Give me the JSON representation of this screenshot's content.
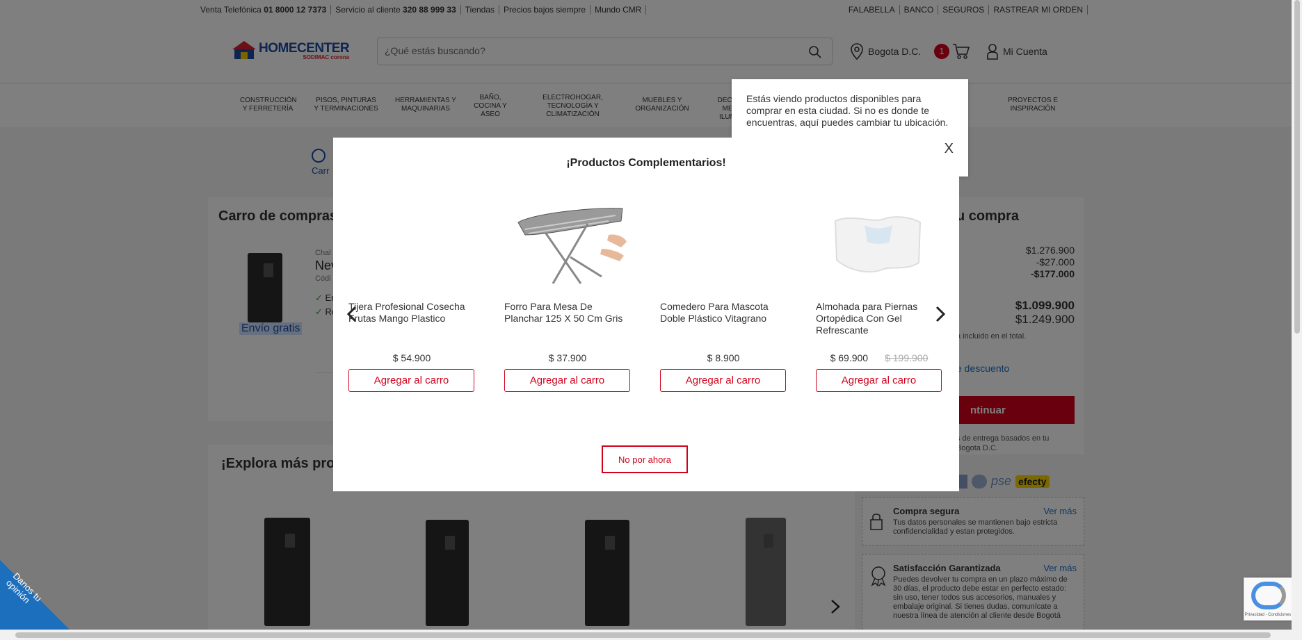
{
  "topbar": {
    "left": [
      "Venta Telefónica",
      "01 8000 12 7373",
      "Servicio al cliente",
      "320 88 999 33",
      "Tiendas",
      "Precios bajos siempre",
      "Mundo CMR"
    ],
    "left_items": [
      "Venta Telefónica 01 8000 12 7373",
      "Servicio al cliente 320 88 999 33",
      "Tiendas",
      "Precios bajos siempre",
      "Mundo CMR"
    ],
    "right_items": [
      "FALABELLA",
      "BANCO",
      "SEGUROS",
      "RASTREAR MI ORDEN"
    ]
  },
  "header": {
    "logo_text": "HOMECENTER",
    "logo_sub": "SODIMAC corona",
    "search_placeholder": "¿Qué estás buscando?",
    "location": "Bogota D.C.",
    "cart_count": "1",
    "account": "Mi Cuenta"
  },
  "nav": {
    "categories": [
      "CONSTRUCCIÓN Y FERRETERÍA",
      "PISOS, PINTURAS Y TERMINACIONES",
      "HERRAMIENTAS Y MAQUINARIAS",
      "BAÑO, COCINA Y ASEO",
      "ELECTROHOGAR, TECNOLOGÍA Y CLIMATIZACIÓN",
      "MUEBLES Y ORGANIZACIÓN",
      "DECO ME ILUM",
      "PROYECTOS E INSPIRACIÓN"
    ]
  },
  "location_popup": {
    "text": "Estás viendo productos disponibles para comprar en esta ciudad. Si no es donde te encuentras, aquí puedes cambiar tu ubicación."
  },
  "background": {
    "stepper_label": "Carr",
    "cart_title": "Carro de compras",
    "item_brand": "Chal",
    "item_name": "Nev",
    "item_code": "Códi",
    "check1": "En",
    "check2": "Re",
    "envio": "Envío gratis",
    "summary_title": "u compra",
    "summary_vals": [
      "$1.276.900",
      "-$27.000",
      "-$177.000"
    ],
    "total1": "$1.099.900",
    "total2": "$1.249.900",
    "iva_note": "á incluido en el total.",
    "discount_link": "e descuento",
    "continue_btn": "ntinuar",
    "delivery_note": "s de entrega basados en tu Bogota D.C.",
    "explore_title": "¡Explora más prod",
    "secure_title": "Compra segura",
    "secure_link": "Ver más",
    "secure_text": "Tus datos personales se mantienen bajo estricta confidencialidad y estan protegidos.",
    "guarantee_title": "Satisfacción Garantizada",
    "guarantee_link": "Ver más",
    "guarantee_text": "Puedes devolver tu compra en un plazo máximo de 30 días, el producto debe estar en perfecto estado: sin uso, tener todos sus accesorios, manuales y embalaje original. Si tienes dudas, comunícate a nuestra línea de atención al cliente desde Bogotá",
    "pay_pse": "pse",
    "pay_efecty": "efecty",
    "opinion": "Danos tu opinión",
    "recaptcha": "Privacidad - Condiciones"
  },
  "modal": {
    "title": "¡Productos Complementarios!",
    "close": "X",
    "not_now": "No por ahora",
    "add_label": "Agregar al carro",
    "products": [
      {
        "name": "Tijera Profesional Cosecha Frutas Mango Plastico",
        "price": "$ 54.900",
        "old_price": ""
      },
      {
        "name": "Forro Para Mesa De Planchar 125 X 50 Cm Gris",
        "price": "$ 37.900",
        "old_price": ""
      },
      {
        "name": "Comedero Para Mascota Doble Plástico Vitagrano",
        "price": "$ 8.900",
        "old_price": ""
      },
      {
        "name": "Almohada para Piernas Ortopédica Con Gel Refrescante",
        "price": "$ 69.900",
        "old_price": "$ 199.900"
      }
    ]
  },
  "colors": {
    "brand_red": "#d0021b",
    "brand_blue": "#1b4aa0"
  }
}
